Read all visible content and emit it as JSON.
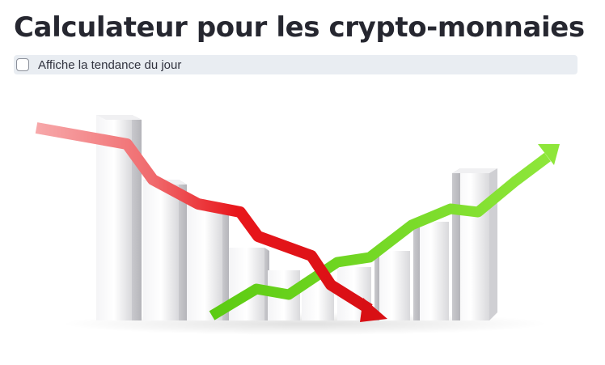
{
  "page": {
    "title": "Calculateur pour les crypto-monnaies"
  },
  "trend_toggle": {
    "label": "Affiche la tendance du jour",
    "checked": false
  },
  "illustration": {
    "description_icon": "trend-chart-illustration",
    "colors": {
      "down_arrow": "#e8161b",
      "up_arrow": "#6fd21a",
      "bars": "#e4e4e6"
    }
  }
}
